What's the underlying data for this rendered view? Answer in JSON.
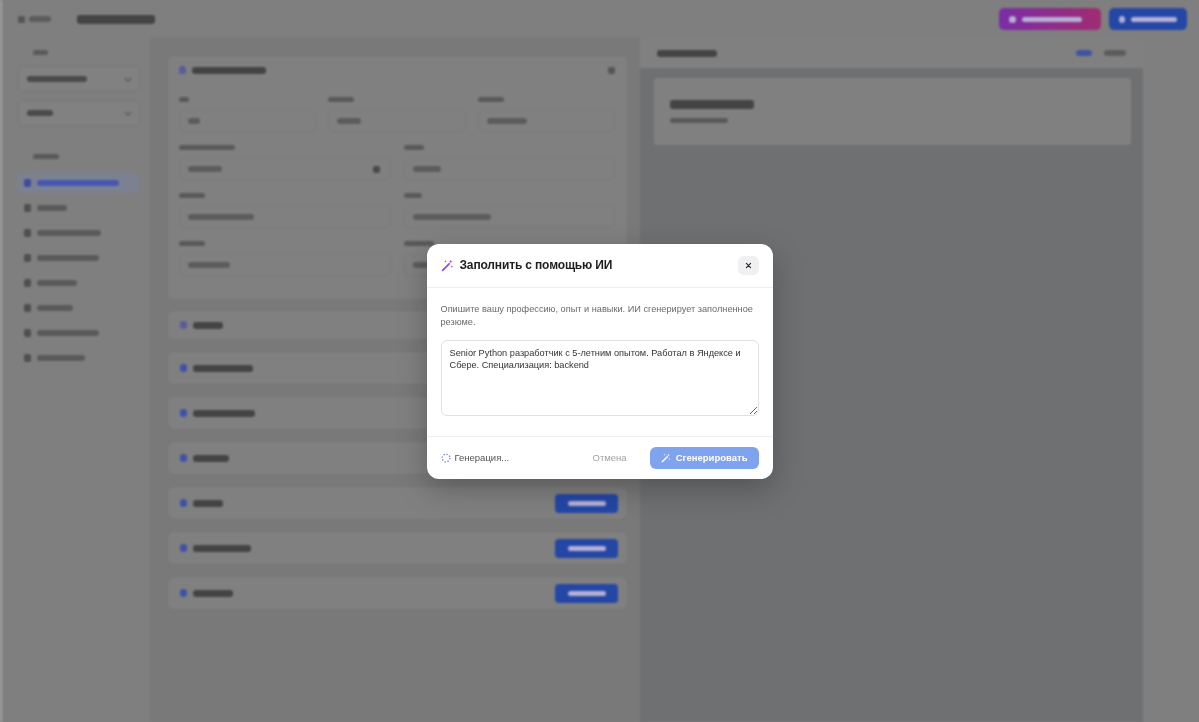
{
  "backdrop": {
    "blurred": true,
    "sidebar_items": [
      {
        "selected": true
      },
      {
        "selected": false
      },
      {
        "selected": false
      },
      {
        "selected": false
      },
      {
        "selected": false
      },
      {
        "selected": false
      },
      {
        "selected": false
      },
      {
        "selected": false
      }
    ]
  },
  "modal": {
    "title": "Заполнить с помощью ИИ",
    "description": "Опишите вашу профессию, опыт и навыки. ИИ сгенерирует заполненное резюме.",
    "prompt": {
      "value": "Senior Python разработчик с 5-летним опытом. Работал в Яндексе и Сбере. Специализация: backend"
    },
    "status": {
      "text": "Генерация...",
      "loading": true
    },
    "buttons": [
      {
        "label": "Отмена",
        "kind": "secondary",
        "disabled": true
      },
      {
        "label": "Сгенерировать",
        "kind": "primary",
        "disabled": true
      }
    ]
  }
}
